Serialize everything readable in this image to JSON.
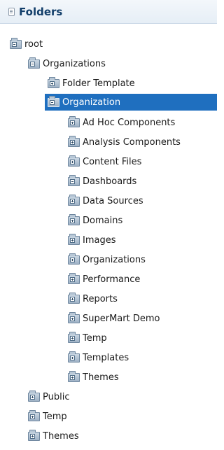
{
  "panel": {
    "title": "Folders"
  },
  "tree": {
    "root": "root",
    "organizations": "Organizations",
    "folder_template": "Folder Template",
    "organization": "Organization",
    "children": [
      "Ad Hoc Components",
      "Analysis Components",
      "Content Files",
      "Dashboards",
      "Data Sources",
      "Domains",
      "Images",
      "Organizations",
      "Performance",
      "Reports",
      "SuperMart Demo",
      "Temp",
      "Templates",
      "Themes"
    ],
    "public": "Public",
    "temp": "Temp",
    "themes": "Themes"
  }
}
